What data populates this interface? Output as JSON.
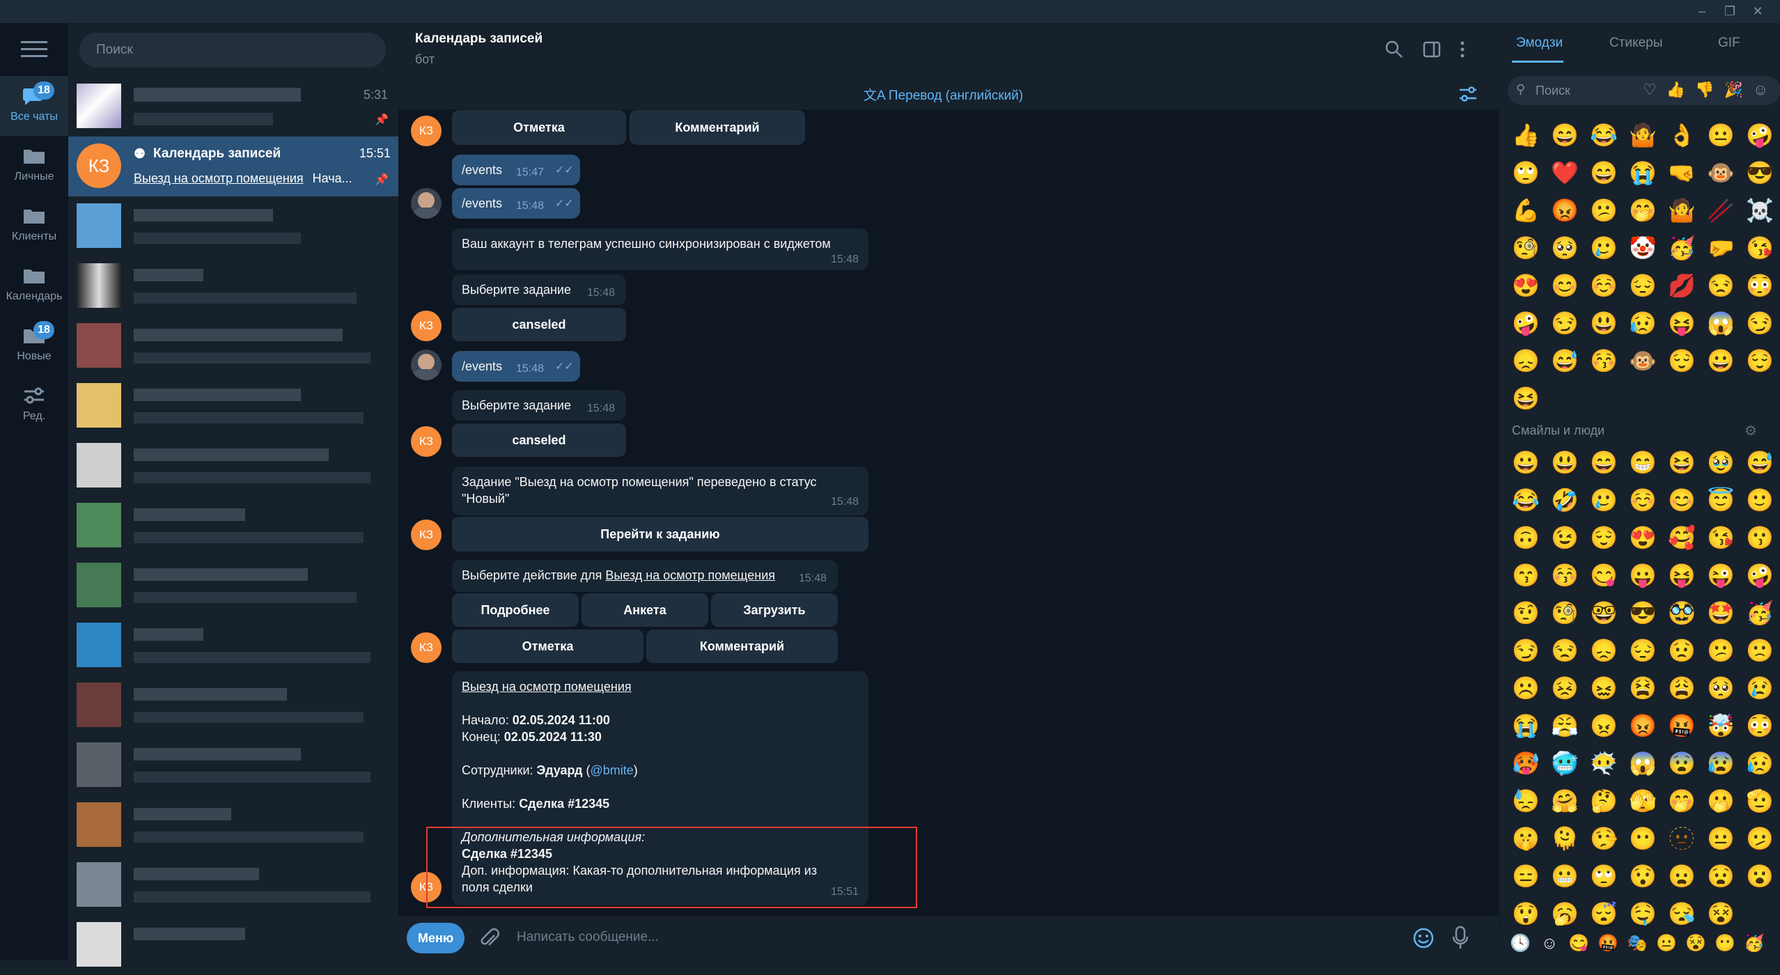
{
  "folders": [
    {
      "label": "Все чаты",
      "badge": "18"
    },
    {
      "label": "Личные"
    },
    {
      "label": "Клиенты"
    },
    {
      "label": "Календарь"
    },
    {
      "label": "Новые",
      "badge": "18"
    },
    {
      "label": "Ред."
    }
  ],
  "search": {
    "placeholder": "Поиск"
  },
  "chats": {
    "first_time": "5:31",
    "active": {
      "avatar": "КЗ",
      "title": "Календарь записей",
      "time": "15:51",
      "preview_link": "Выезд на осмотр помещения",
      "preview_rest": "Нача..."
    }
  },
  "header": {
    "title": "Календарь записей",
    "subtitle": "бот"
  },
  "translate": {
    "label": "Перевод (английский)"
  },
  "messages": {
    "kb1": [
      "Отметка",
      "Комментарий"
    ],
    "out1": {
      "text": "/events",
      "time": "15:47"
    },
    "out2": {
      "text": "/events",
      "time": "15:48"
    },
    "sync": {
      "text": "Ваш аккаунт в телеграм успешно синхронизирован с виджетом",
      "time": "15:48"
    },
    "choose1": {
      "text": "Выберите задание",
      "time": "15:48",
      "button": "canseled"
    },
    "out3": {
      "text": "/events",
      "time": "15:48"
    },
    "choose2": {
      "text": "Выберите задание",
      "time": "15:48",
      "button": "canseled"
    },
    "status": {
      "line1": "Задание \"Выезд на осмотр помещения\" переведено в статус",
      "line2": "\"Новый\"",
      "time": "15:48",
      "button": "Перейти к заданию"
    },
    "action": {
      "prefix": "Выберите действие для ",
      "link": "Выезд на осмотр помещения",
      "time": "15:48",
      "row1": [
        "Подробнее",
        "Анкета",
        "Загрузить"
      ],
      "row2": [
        "Отметка",
        "Комментарий"
      ]
    },
    "details": {
      "title": "Выезд на осмотр помещения",
      "start_label": "Начало: ",
      "start": "02.05.2024 11:00",
      "end_label": "Конец: ",
      "end": "02.05.2024 11:30",
      "staff_label": "Сотрудники: ",
      "staff_name": "Эдуард",
      "staff_open": " (",
      "staff_handle": "@bmite",
      "staff_close": ")",
      "clients_label": "Клиенты: ",
      "clients": "Сделка #12345",
      "extra_label": "Дополнительная информация:",
      "extra_deal": "Сделка #12345",
      "extra_line1": "Доп. информация: Какая-то дополнительная информация из",
      "extra_line2": "поля сделки",
      "time": "15:51"
    },
    "bot_avatar": "КЗ"
  },
  "composer": {
    "menu": "Меню",
    "placeholder": "Написать сообщение..."
  },
  "emoji_panel": {
    "tabs": [
      "Эмодзи",
      "Стикеры",
      "GIF"
    ],
    "search_placeholder": "Поиск",
    "category": "Смайлы и люди",
    "recent": [
      "👍",
      "😄",
      "😂",
      "🤷",
      "👌",
      "😐",
      "🤪",
      "🙄",
      "❤️",
      "😄",
      "😭",
      "🤜",
      "🐵",
      "😎",
      "💪",
      "😡",
      "😕",
      "🤭",
      "🤷",
      "🥢",
      "☠️",
      "🧐",
      "🥺",
      "🥲",
      "🤡",
      "🥳",
      "🤛",
      "😘",
      "😍",
      "😊",
      "☺️",
      "😔",
      "💋",
      "😒",
      "😳",
      "🤪",
      "😏",
      "😃",
      "😥",
      "😝",
      "😱",
      "😏",
      "😞",
      "😅",
      "😚",
      "🐵",
      "😌",
      "😀",
      "😌",
      "😆"
    ],
    "smileys": [
      "😀",
      "😃",
      "😄",
      "😁",
      "😆",
      "🥹",
      "😅",
      "😂",
      "🤣",
      "🥲",
      "☺️",
      "😊",
      "😇",
      "🙂",
      "🙃",
      "😉",
      "😌",
      "😍",
      "🥰",
      "😘",
      "😗",
      "😙",
      "😚",
      "😋",
      "😛",
      "😝",
      "😜",
      "🤪",
      "🤨",
      "🧐",
      "🤓",
      "😎",
      "🥸",
      "🤩",
      "🥳",
      "😏",
      "😒",
      "😞",
      "😔",
      "😟",
      "😕",
      "🙁",
      "☹️",
      "😣",
      "😖",
      "😫",
      "😩",
      "🥺",
      "😢",
      "😭",
      "😤",
      "😠",
      "😡",
      "🤬",
      "🤯",
      "😳",
      "🥵",
      "🥶",
      "😶‍🌫️",
      "😱",
      "😨",
      "😰",
      "😥",
      "😓",
      "🤗",
      "🤔",
      "🫣",
      "🤭",
      "🫢",
      "🫡",
      "🤫",
      "🫠",
      "🤥",
      "😶",
      "🫥",
      "😐",
      "🫤",
      "😑",
      "😬",
      "🙄",
      "😯",
      "😦",
      "😧",
      "😮",
      "😲",
      "🥱",
      "😴",
      "🤤",
      "😪",
      "😵"
    ],
    "bottom": [
      "🕓",
      "☺",
      "😋",
      "🤬",
      "🎭",
      "😐",
      "😵",
      "😶",
      "🥳"
    ]
  }
}
